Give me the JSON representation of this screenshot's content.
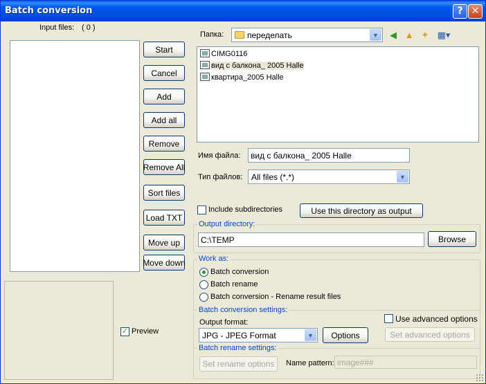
{
  "window": {
    "title": "Batch conversion"
  },
  "input_files": {
    "label": "Input files:",
    "count": "( 0 )"
  },
  "left_buttons": {
    "start": "Start",
    "cancel": "Cancel",
    "add": "Add",
    "add_all": "Add all",
    "remove": "Remove",
    "remove_all": "Remove All",
    "sort_files": "Sort files",
    "load_txt": "Load TXT",
    "move_up": "Move up",
    "move_down": "Move down"
  },
  "preview": {
    "label": "Preview",
    "checked": true
  },
  "browser": {
    "folder_label": "Папка:",
    "folder_value": "переделать",
    "files": [
      {
        "name": "CIMG0116",
        "selected": false
      },
      {
        "name": "вид с балкона_ 2005 Halle",
        "selected": true
      },
      {
        "name": "квартира_2005 Halle",
        "selected": false
      }
    ],
    "filename_label": "Имя файла:",
    "filename_value": "вид с балкона_ 2005 Halle",
    "filetype_label": "Тип файлов:",
    "filetype_value": "All files (*.*)"
  },
  "include_subdirs": {
    "label": "Include subdirectories",
    "checked": false
  },
  "use_dir_output": "Use this directory as output",
  "output": {
    "group_title": "Output directory:",
    "value": "C:\\TEMP",
    "browse": "Browse"
  },
  "work_as": {
    "group_title": "Work as:",
    "options": [
      "Batch conversion",
      "Batch rename",
      "Batch conversion - Rename result files"
    ],
    "selected_index": 0
  },
  "conversion_settings": {
    "group_title": "Batch conversion settings:",
    "format_label": "Output format:",
    "format_value": "JPG - JPEG Format",
    "options_button": "Options",
    "advanced_label": "Use advanced options",
    "set_advanced": "Set advanced options"
  },
  "rename_settings": {
    "group_title": "Batch rename settings:",
    "set_rename": "Set rename options",
    "pattern_label": "Name pattern:",
    "pattern_value": "image###"
  },
  "colors": {
    "title_bar": "#0058ee",
    "group_title": "#0046d5",
    "dialog_bg": "#ece9d8"
  }
}
